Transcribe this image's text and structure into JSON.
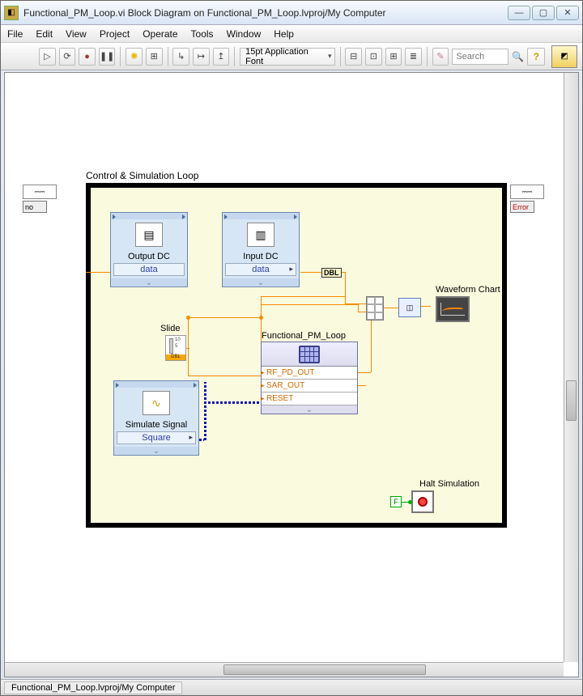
{
  "window": {
    "title": "Functional_PM_Loop.vi Block Diagram on Functional_PM_Loop.lvproj/My Computer"
  },
  "menu": {
    "file": "File",
    "edit": "Edit",
    "view": "View",
    "project": "Project",
    "operate": "Operate",
    "tools": "Tools",
    "window": "Window",
    "help": "Help"
  },
  "toolbar": {
    "font": "15pt Application Font",
    "search_placeholder": "Search"
  },
  "diagram": {
    "loop_label": "Control & Simulation Loop",
    "left_tunnel": "no",
    "right_tunnel": "Error",
    "output_dc": {
      "title": "Output DC",
      "field": "data"
    },
    "input_dc": {
      "title": "Input DC",
      "field": "data"
    },
    "dbl": "DBL",
    "slide": {
      "label": "Slide",
      "t1": "10",
      "t2": "5",
      "unit": "DBL"
    },
    "sim_signal": {
      "title": "Simulate Signal",
      "field": "Square"
    },
    "pm_loop": {
      "label": "Functional_PM_Loop",
      "rows": [
        "RF_PD_OUT",
        "SAR_OUT",
        "RESET"
      ]
    },
    "waveform_chart": "Waveform Chart",
    "halt": "Halt Simulation",
    "fconst": "F"
  },
  "statusbar": {
    "context": "Functional_PM_Loop.lvproj/My Computer"
  }
}
